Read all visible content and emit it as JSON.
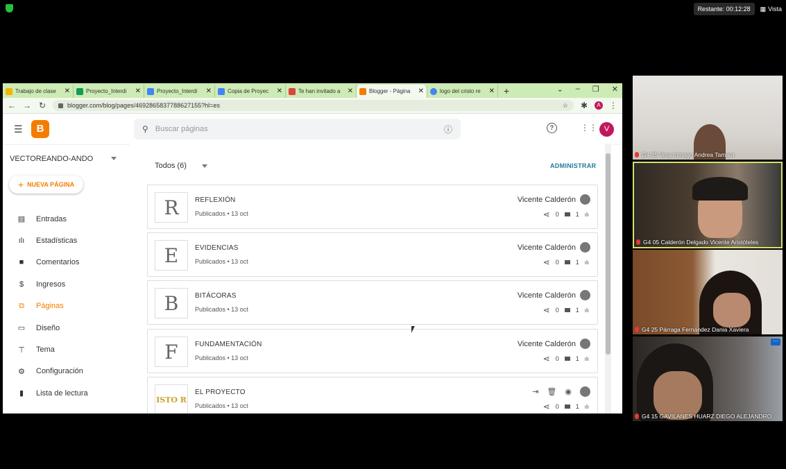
{
  "zoom": {
    "timer": "Restante: 00:12:28",
    "vista": "Vista"
  },
  "browser": {
    "tabs": [
      {
        "label": "Trabajo de clase",
        "color": "#f4b400"
      },
      {
        "label": "Proyecto_Interdi",
        "color": "#0f9d58"
      },
      {
        "label": "Proyecto_Interdi",
        "color": "#4285f4"
      },
      {
        "label": "Copia de Proyec",
        "color": "#4285f4"
      },
      {
        "label": "Te han invitado a",
        "color": "#db4437"
      },
      {
        "label": "Blogger - Página",
        "color": "#f57c00"
      },
      {
        "label": "logo del cristo re",
        "color": "#4285f4"
      }
    ],
    "url": "blogger.com/blog/pages/4692865837788627155?hl=es",
    "profile_initial": "A"
  },
  "blogger": {
    "search_placeholder": "Buscar páginas",
    "user_initial": "V",
    "blog_name": "VECTOREANDO-ANDO",
    "new_page": "NUEVA PÁGINA",
    "nav": [
      {
        "label": "Entradas",
        "icon": "▤"
      },
      {
        "label": "Estadísticas",
        "icon": "ılı"
      },
      {
        "label": "Comentarios",
        "icon": "■"
      },
      {
        "label": "Ingresos",
        "icon": "$"
      },
      {
        "label": "Páginas",
        "icon": "⧉"
      },
      {
        "label": "Diseño",
        "icon": "▭"
      },
      {
        "label": "Tema",
        "icon": "⊤"
      },
      {
        "label": "Configuración",
        "icon": "⚙"
      },
      {
        "label": "Lista de lectura",
        "icon": "▮"
      }
    ],
    "filter": "Todos (6)",
    "admin": "ADMINISTRAR",
    "pages": [
      {
        "letter": "R",
        "title": "REFLEXIÓN",
        "meta": "Publicados • 13 oct",
        "author": "Vicente Calderón",
        "comments": "0",
        "views": "1"
      },
      {
        "letter": "E",
        "title": "EVIDENCIAS",
        "meta": "Publicados • 13 oct",
        "author": "Vicente Calderón",
        "comments": "0",
        "views": "1"
      },
      {
        "letter": "B",
        "title": "BITÁCORAS",
        "meta": "Publicados • 13 oct",
        "author": "Vicente Calderón",
        "comments": "0",
        "views": "1"
      },
      {
        "letter": "F",
        "title": "FUNDAMENTACIÓN",
        "meta": "Publicados • 13 oct",
        "author": "Vicente Calderón",
        "comments": "0",
        "views": "1"
      },
      {
        "letter": "ISTO R",
        "title": "EL PROYECTO",
        "meta": "Publicados • 13 oct",
        "author": "",
        "comments": "0",
        "views": "1"
      }
    ]
  },
  "participants": [
    {
      "name": "G4 35 Vera Intriago Andrea Tamara"
    },
    {
      "name": "G4 05 Calderón Delgado Vicente Aristóteles"
    },
    {
      "name": "G4 25 Párraga Fernández Dania Xaviera"
    },
    {
      "name": "G4 15 GAVILANES HUARZ DIEGO ALEJANDRO"
    }
  ]
}
